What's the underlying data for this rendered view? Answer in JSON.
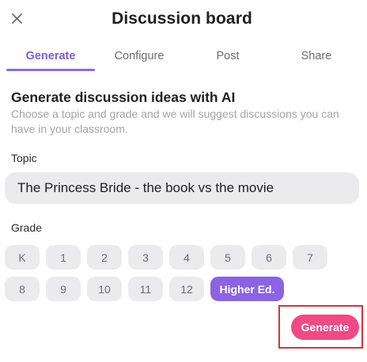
{
  "header": {
    "title": "Discussion board",
    "close_icon": "close-icon"
  },
  "tabs": [
    {
      "label": "Generate",
      "active": true
    },
    {
      "label": "Configure",
      "active": false
    },
    {
      "label": "Post",
      "active": false
    },
    {
      "label": "Share",
      "active": false
    }
  ],
  "main": {
    "heading": "Generate discussion ideas with AI",
    "description": "Choose a topic and grade and we will suggest discussions you can have in your classroom.",
    "topic": {
      "label": "Topic",
      "value": "The Princess Bride - the book vs the movie"
    },
    "grade": {
      "label": "Grade",
      "options_row1": [
        "K",
        "1",
        "2",
        "3",
        "4",
        "5",
        "6",
        "7"
      ],
      "options_row2": [
        "8",
        "9",
        "10",
        "11",
        "12",
        "Higher Ed."
      ],
      "selected": "Higher Ed."
    },
    "generate_label": "Generate"
  },
  "colors": {
    "accent": "#8b63e4",
    "tab_active": "#7c5cd8",
    "generate": "#ef4a86",
    "highlight": "#d8323a"
  }
}
